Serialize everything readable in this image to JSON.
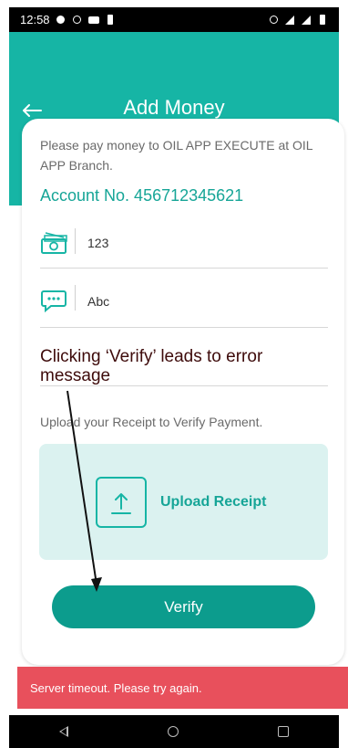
{
  "status_bar": {
    "time": "12:58"
  },
  "header": {
    "title": "Add Money",
    "back_icon": "arrow-left-icon"
  },
  "form": {
    "instruction": "Please pay money to OIL APP EXECUTE at OIL APP Branch.",
    "account": "Account No. 456712345621",
    "amount_value": "123",
    "amount_icon": "money-icon",
    "remarks_value": "Abc",
    "remarks_icon": "chat-icon",
    "upload_hint": "Upload your Receipt to Verify Payment.",
    "upload_label": "Upload Receipt",
    "upload_icon": "upload-icon",
    "verify_label": "Verify"
  },
  "annotation": "Clicking ‘Verify’ leads to error message",
  "toast": "Server timeout. Please try again.",
  "colors": {
    "primary": "#16b5a5",
    "button": "#0c9c8d",
    "error": "#e8505c",
    "upload_bg": "#dbf2f0"
  }
}
